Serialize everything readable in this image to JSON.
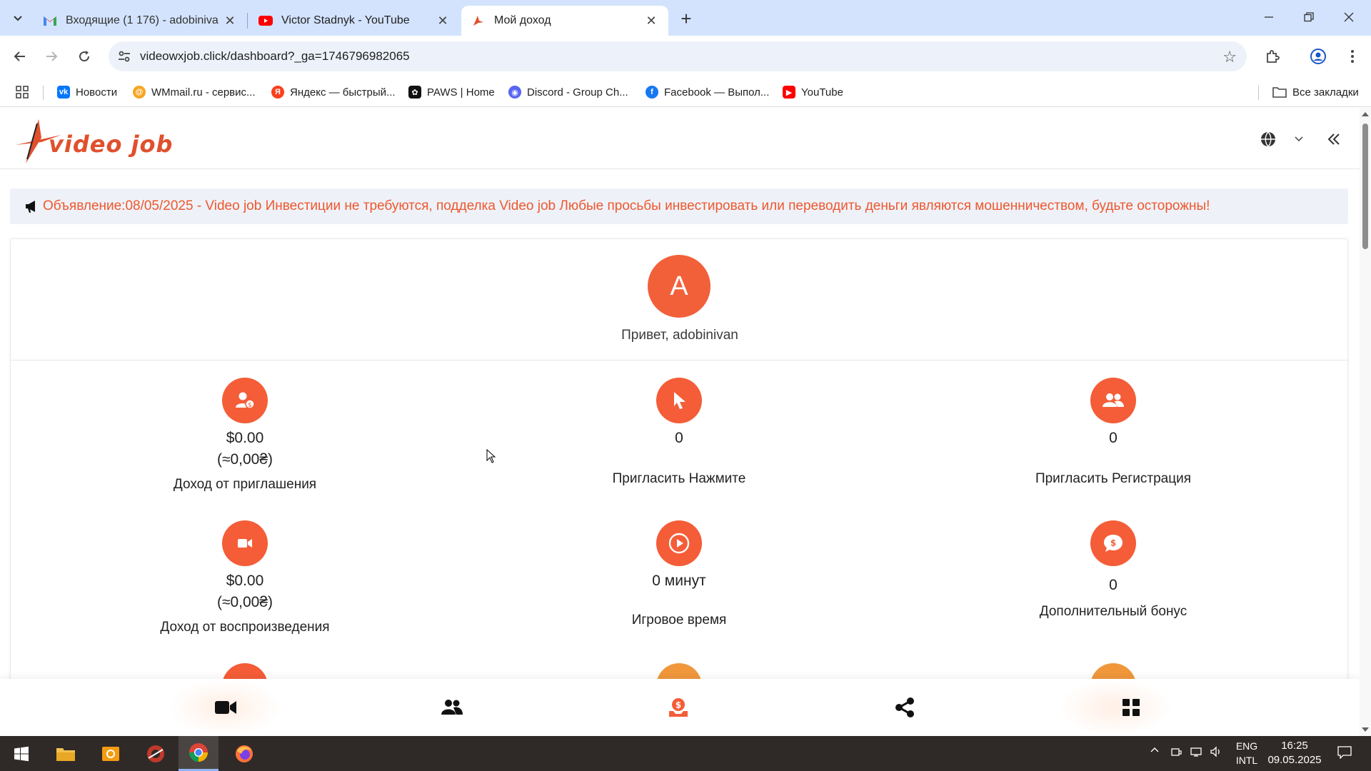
{
  "browser": {
    "tabs": [
      {
        "title": "Входящие (1 176) - adobinivan",
        "favicon": "gmail-icon",
        "active": false
      },
      {
        "title": "Victor Stadnyk - YouTube",
        "favicon": "youtube-icon",
        "active": false
      },
      {
        "title": "Мой доход",
        "favicon": "videojob-icon",
        "active": true
      }
    ],
    "url": "videowxjob.click/dashboard?_ga=1746796982065",
    "bookmarks": [
      {
        "label": "Новости",
        "icon": "vk-icon",
        "color": "#0077ff"
      },
      {
        "label": "WMmail.ru - сервис...",
        "icon": "wmmail-icon",
        "color": "#f5a623"
      },
      {
        "label": "Яндекс — быстрый...",
        "icon": "yandex-icon",
        "color": "#fc3f1d"
      },
      {
        "label": "PAWS | Home",
        "icon": "paws-icon",
        "color": "#111111"
      },
      {
        "label": "Discord - Group Ch...",
        "icon": "discord-icon",
        "color": "#5865f2"
      },
      {
        "label": "Facebook — Выпол...",
        "icon": "facebook-icon",
        "color": "#1877f2"
      },
      {
        "label": "YouTube",
        "icon": "youtube-icon",
        "color": "#ff0000"
      }
    ],
    "all_bookmarks": "Все закладки"
  },
  "site": {
    "logo_text": "video job",
    "announcement": "Объявление:08/05/2025 - Video job Инвестиции не требуются, подделка Video job Любые просьбы инвестировать или переводить деньги являются мошенничеством, будьте осторожны!",
    "avatar_letter": "A",
    "greeting": "Привет, adobinivan",
    "accent_color": "#f45d37",
    "stats": [
      {
        "icon": "invite-income-icon",
        "value": "$0.00",
        "sub": "(≈0,00₴)",
        "label": "Доход от приглашения"
      },
      {
        "icon": "pointer-icon",
        "value": "0",
        "sub": "",
        "label": "Пригласить Нажмите"
      },
      {
        "icon": "users-icon",
        "value": "0",
        "sub": "",
        "label": "Пригласить Регистрация"
      },
      {
        "icon": "video-camera-icon",
        "value": "$0.00",
        "sub": "(≈0,00₴)",
        "label": "Доход от воспроизведения"
      },
      {
        "icon": "play-circle-icon",
        "value": "0 минут",
        "sub": "",
        "label": "Игровое время"
      },
      {
        "icon": "bonus-chat-icon",
        "value": "0",
        "sub": "",
        "label": "Дополнительный бонус"
      }
    ],
    "bottom_nav": [
      {
        "icon": "video-camera-icon",
        "name": "nav-videos"
      },
      {
        "icon": "users-icon",
        "name": "nav-team"
      },
      {
        "icon": "income-icon",
        "name": "nav-income"
      },
      {
        "icon": "share-icon",
        "name": "nav-share"
      },
      {
        "icon": "grid-icon",
        "name": "nav-menu"
      }
    ]
  },
  "taskbar": {
    "lang_line1": "ENG",
    "lang_line2": "INTL",
    "time": "16:25",
    "date": "09.05.2025"
  }
}
